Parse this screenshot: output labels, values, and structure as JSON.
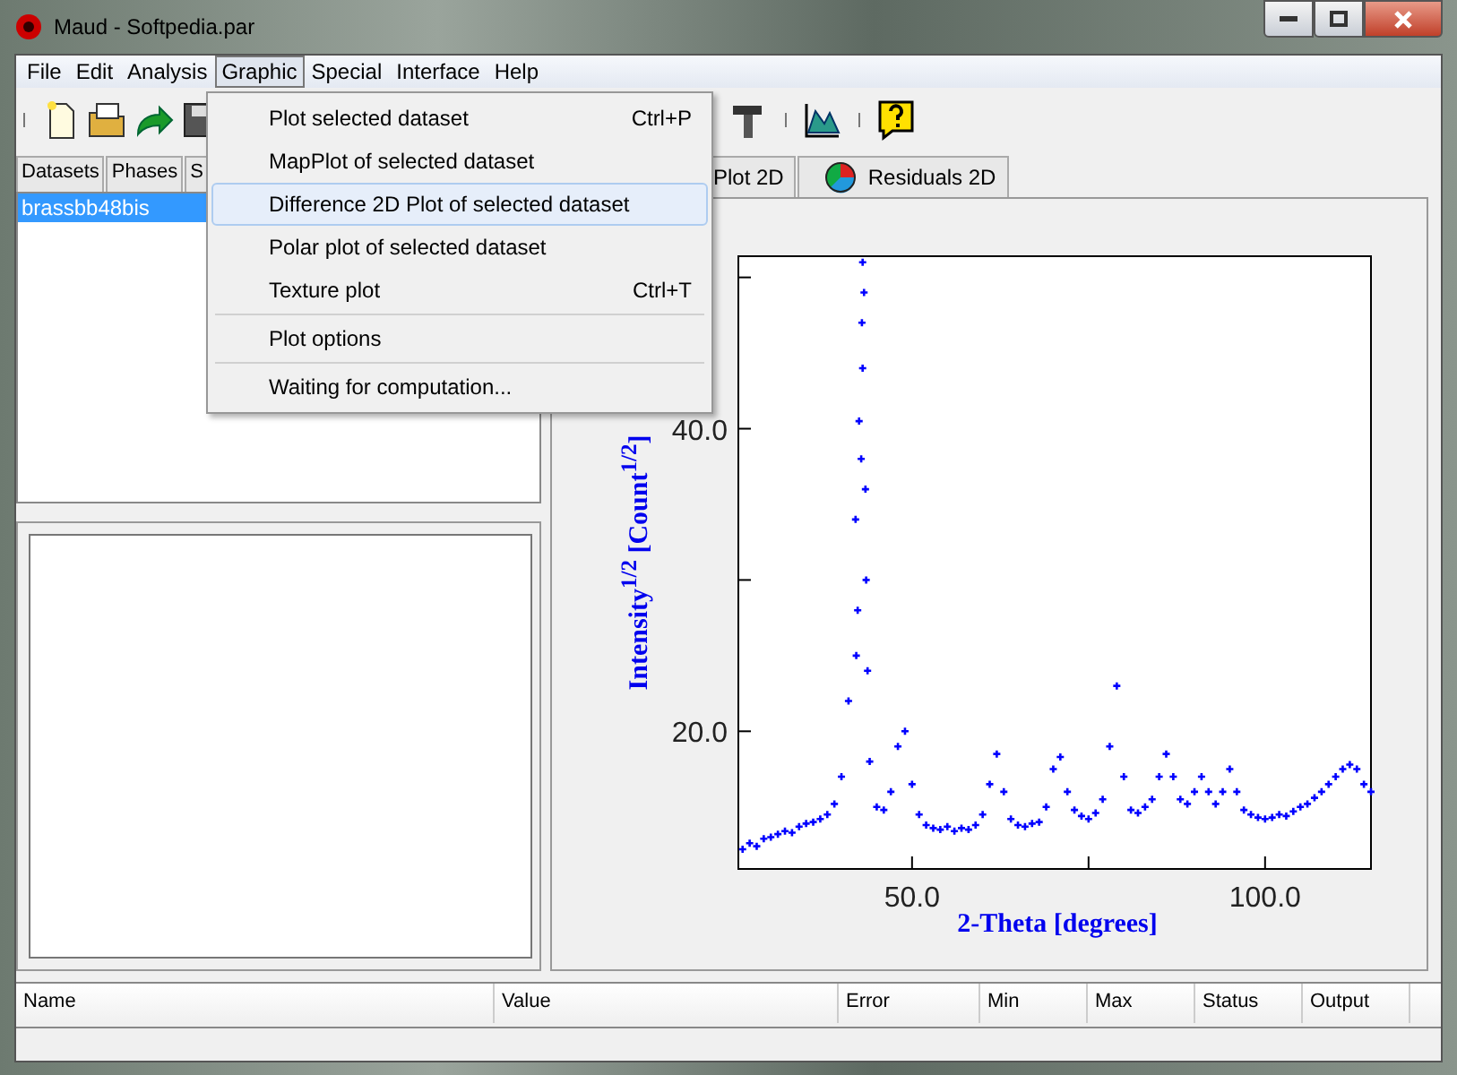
{
  "window": {
    "title": "Maud - Softpedia.par"
  },
  "menu_bar": [
    {
      "label": "File",
      "selected": false
    },
    {
      "label": "Edit",
      "selected": false
    },
    {
      "label": "Analysis",
      "selected": false
    },
    {
      "label": "Graphic",
      "selected": true
    },
    {
      "label": "Special",
      "selected": false
    },
    {
      "label": "Interface",
      "selected": false
    },
    {
      "label": "Help",
      "selected": false
    }
  ],
  "toolbar": [
    {
      "kind": "new"
    },
    {
      "kind": "open"
    },
    {
      "kind": "forward"
    },
    {
      "kind": "save"
    },
    {
      "kind": "gap"
    },
    {
      "kind": "hammer"
    },
    {
      "kind": "chart"
    },
    {
      "kind": "help"
    }
  ],
  "left_tabs": [
    {
      "label": "Datasets"
    },
    {
      "label": "Phases"
    },
    {
      "label": "S"
    }
  ],
  "dataset_list": [
    {
      "label": "brassbb48bis",
      "selected": true
    }
  ],
  "right_tabs": [
    {
      "label": "Plot 2D",
      "kind": "plain"
    },
    {
      "label": "Residuals 2D",
      "kind": "residuals"
    }
  ],
  "chart": {
    "chart_data": {
      "type": "scatter",
      "xlabel": "2-Theta [degrees]",
      "ylabel": "Intensity$^{1/2}$ [Count$^{1/2}$]",
      "xlim": [
        25.4,
        115
      ],
      "ylim": [
        10.9,
        51.4
      ],
      "xticks": [
        {
          "value": 50,
          "label": "50.0"
        },
        {
          "value": 100,
          "label": "100.0"
        }
      ],
      "yticks": [
        {
          "value": 20,
          "label": "20.0"
        },
        {
          "value": 40,
          "label": "40.0"
        }
      ],
      "x": [
        26,
        27,
        28,
        29,
        30,
        31,
        32,
        33,
        34,
        35,
        36,
        37,
        38,
        39,
        40,
        41,
        42,
        43,
        44,
        45,
        46,
        47,
        48,
        49,
        50,
        51,
        52,
        53,
        54,
        55,
        56,
        57,
        58,
        59,
        60,
        61,
        62,
        63,
        64,
        65,
        66,
        67,
        68,
        69,
        70,
        71,
        72,
        73,
        74,
        75,
        76,
        77,
        78,
        79,
        80,
        81,
        82,
        83,
        84,
        85,
        86,
        87,
        88,
        89,
        90,
        91,
        92,
        93,
        94,
        95,
        96,
        97,
        98,
        99,
        100,
        101,
        102,
        103,
        104,
        105,
        106,
        107,
        108,
        109,
        110,
        111,
        112,
        113,
        114,
        115,
        42.5,
        43.0,
        43.2,
        42.8,
        43.5,
        42.3,
        43.7,
        42.1,
        43.4,
        42.9
      ],
      "series": [
        {
          "color": "#0000ff",
          "values": [
            12.2,
            12.6,
            12.4,
            12.9,
            13.0,
            13.2,
            13.4,
            13.3,
            13.7,
            13.9,
            14.0,
            14.2,
            14.5,
            15.2,
            17.0,
            22.0,
            34.0,
            44.0,
            18.0,
            15.0,
            14.8,
            16.0,
            19.0,
            20.0,
            16.5,
            14.5,
            13.8,
            13.6,
            13.5,
            13.7,
            13.4,
            13.6,
            13.5,
            13.8,
            14.5,
            16.5,
            18.5,
            16.0,
            14.2,
            13.8,
            13.7,
            13.9,
            14.0,
            15.0,
            17.5,
            18.3,
            16.0,
            14.8,
            14.4,
            14.2,
            14.6,
            15.5,
            19.0,
            23.0,
            17.0,
            14.8,
            14.6,
            15.0,
            15.5,
            17.0,
            18.5,
            17.0,
            15.5,
            15.2,
            16.0,
            17.0,
            16.0,
            15.2,
            16.0,
            17.5,
            16.0,
            14.8,
            14.5,
            14.3,
            14.2,
            14.3,
            14.5,
            14.4,
            14.7,
            15.0,
            15.2,
            15.6,
            16.0,
            16.5,
            17.0,
            17.5,
            17.8,
            17.5,
            16.5,
            16.0,
            40.5,
            51.0,
            49.0,
            38.0,
            30.0,
            28.0,
            24.0,
            25.0,
            36.0,
            47.0
          ]
        }
      ]
    }
  },
  "parameter_table": {
    "columns": [
      "Name",
      "Value",
      "Error",
      "Min",
      "Max",
      "Status",
      "Output"
    ]
  },
  "graphic_menu": [
    {
      "kind": "item",
      "label": "Plot selected dataset",
      "shortcut": "Ctrl+P",
      "selected": false
    },
    {
      "kind": "item",
      "label": "MapPlot of selected dataset",
      "selected": false
    },
    {
      "kind": "item",
      "label": "Difference 2D Plot of selected dataset",
      "selected": true
    },
    {
      "kind": "item",
      "label": "Polar plot of selected dataset",
      "selected": false
    },
    {
      "kind": "item",
      "label": "Texture plot",
      "shortcut": "Ctrl+T",
      "selected": false
    },
    {
      "kind": "separator"
    },
    {
      "kind": "item",
      "label": "Plot options",
      "selected": false
    },
    {
      "kind": "separator"
    },
    {
      "kind": "item",
      "label": "Waiting for computation...",
      "selected": false
    }
  ]
}
